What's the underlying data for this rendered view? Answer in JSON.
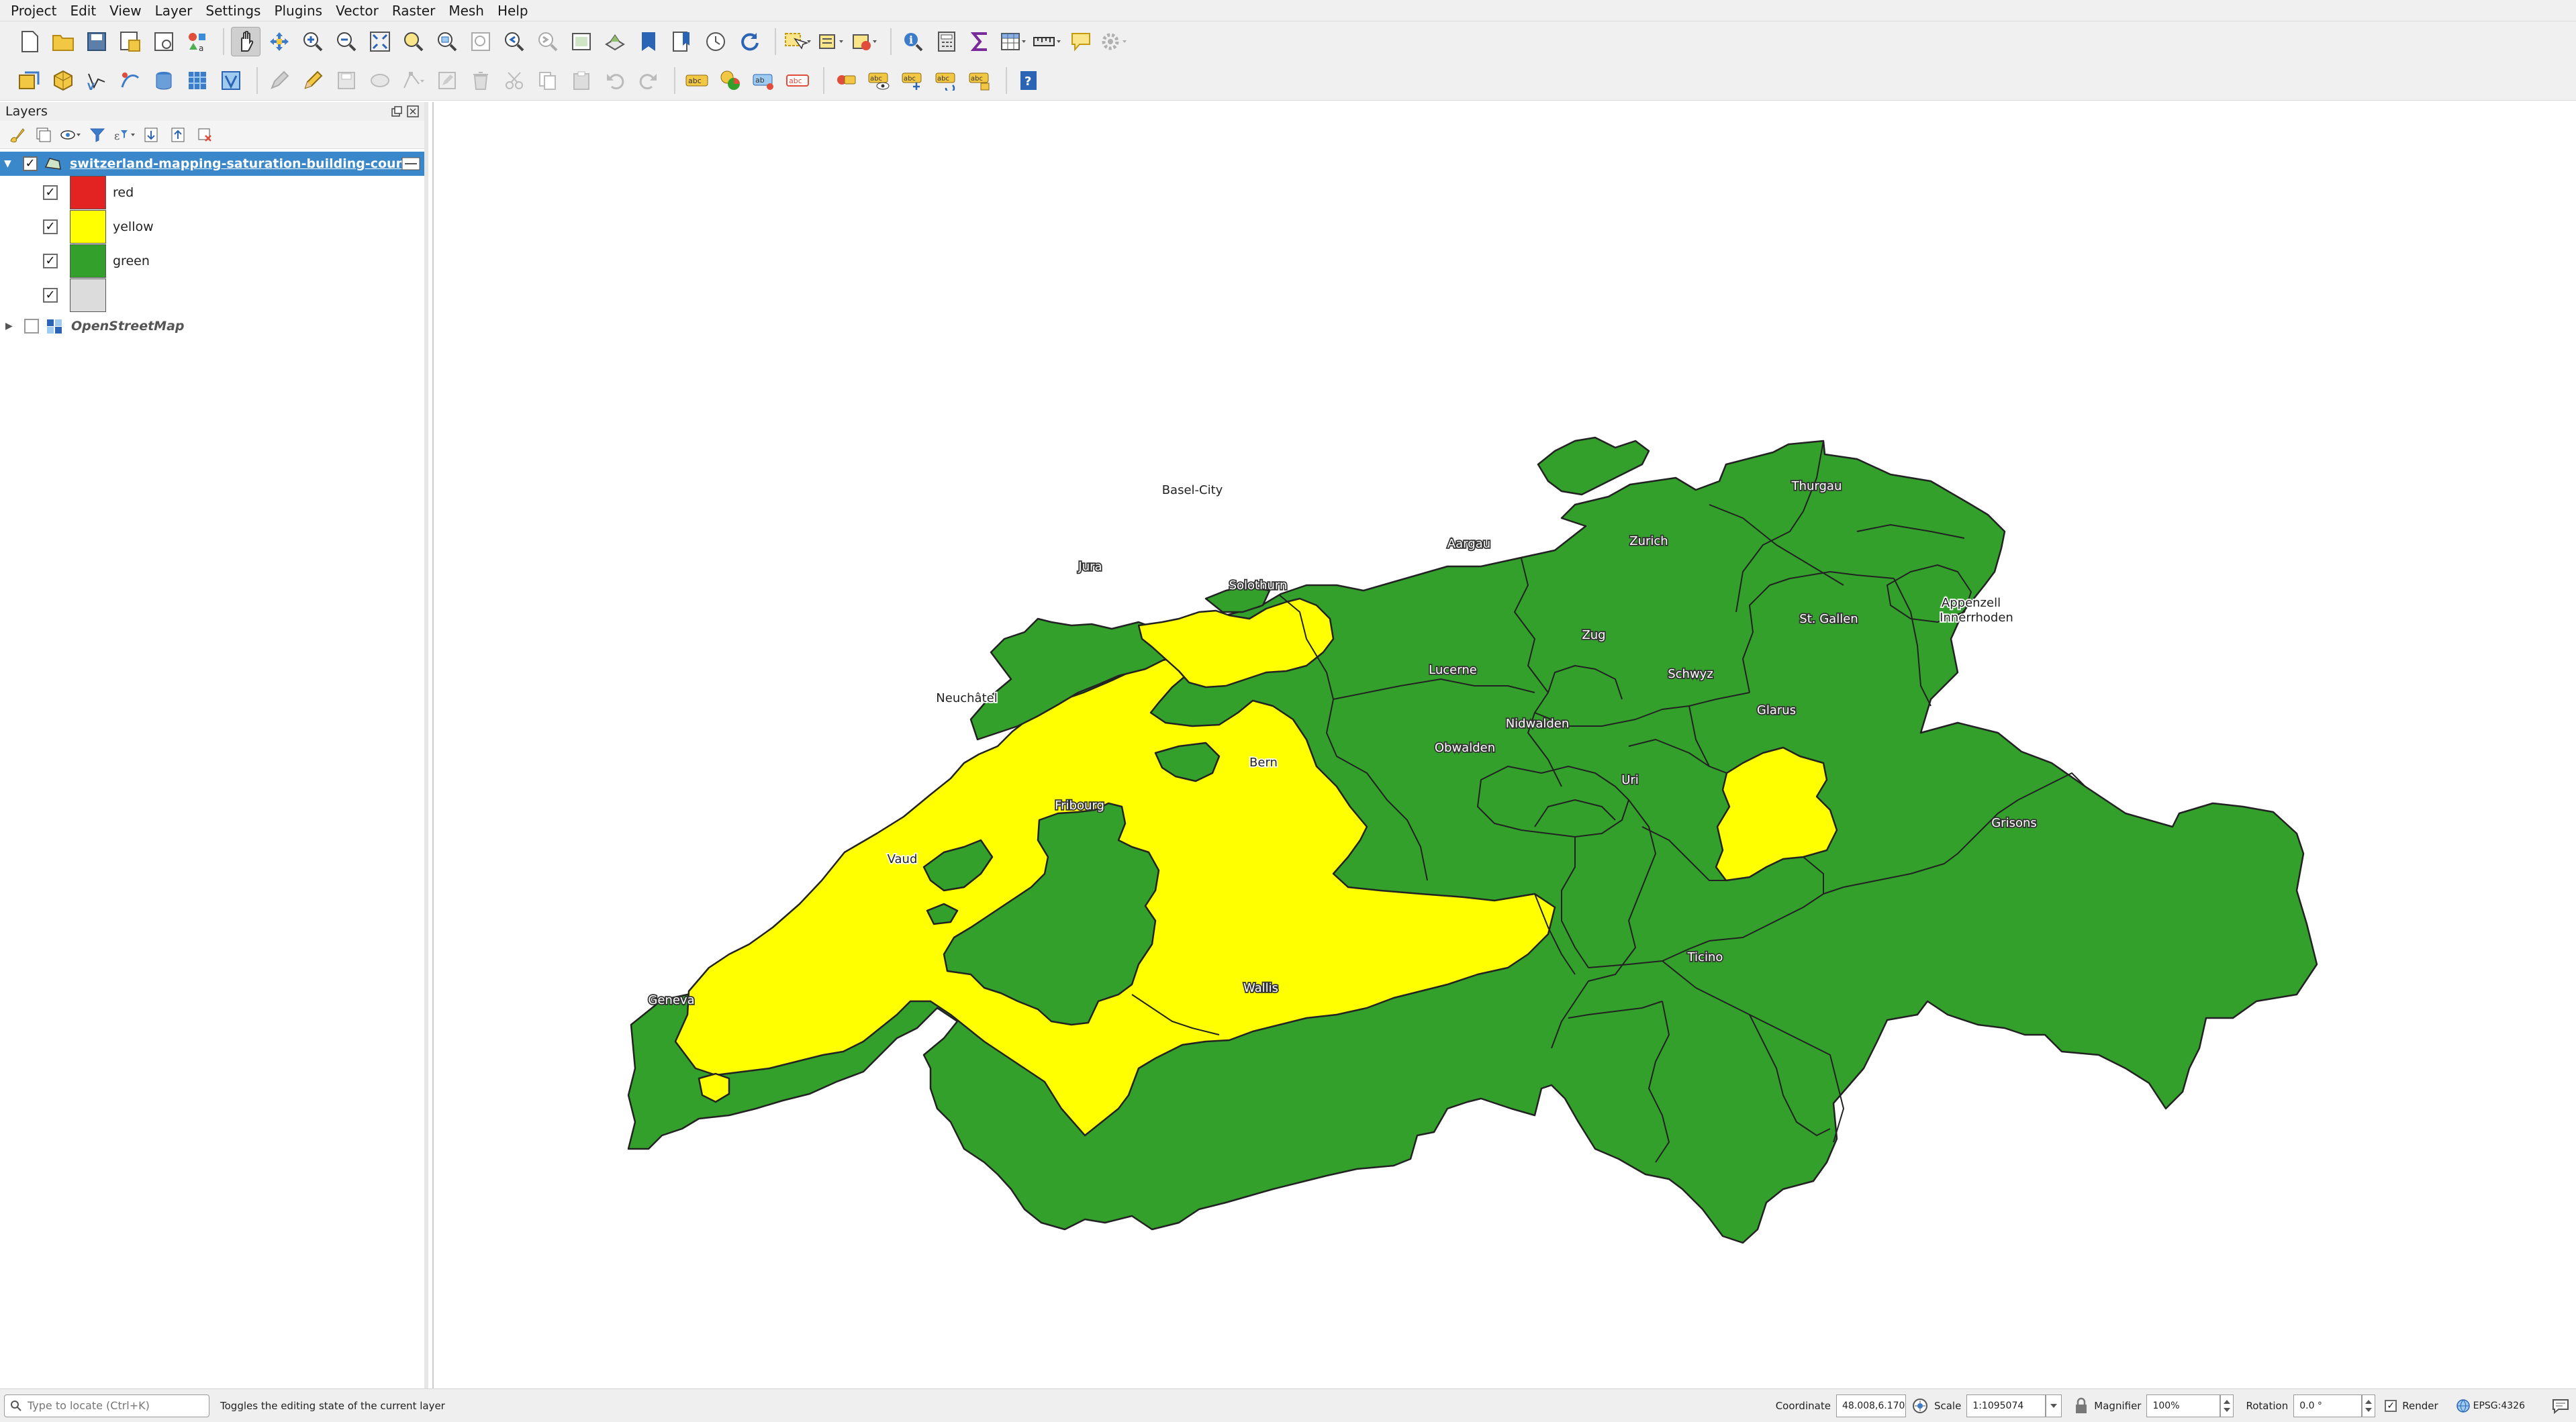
{
  "menu": [
    "Project",
    "Edit",
    "View",
    "Layer",
    "Settings",
    "Plugins",
    "Vector",
    "Raster",
    "Mesh",
    "Help"
  ],
  "layers_panel": {
    "title": "Layers",
    "layer_name": "switzerland-mapping-saturation-building-count",
    "classes": [
      {
        "label": "red",
        "color": "#e32222"
      },
      {
        "label": "yellow",
        "color": "#ffff00"
      },
      {
        "label": "green",
        "color": "#33a02c"
      },
      {
        "label": "",
        "color": "#dcdcdc"
      }
    ],
    "basemap": "OpenStreetMap"
  },
  "map": {
    "fill_green": "#33a02c",
    "fill_yellow": "#ffff00",
    "labels": [
      {
        "text": "Basel-City"
      },
      {
        "text": "Jura"
      },
      {
        "text": "Solothurn"
      },
      {
        "text": "Aargau"
      },
      {
        "text": "Zurich"
      },
      {
        "text": "Thurgau"
      },
      {
        "text": "St. Gallen"
      },
      {
        "text": "Appenzell"
      },
      {
        "text": "Innerrhoden"
      },
      {
        "text": "Neuchâtel"
      },
      {
        "text": "Lucerne"
      },
      {
        "text": "Zug"
      },
      {
        "text": "Schwyz"
      },
      {
        "text": "Glarus"
      },
      {
        "text": "Nidwalden"
      },
      {
        "text": "Obwalden"
      },
      {
        "text": "Bern"
      },
      {
        "text": "Uri"
      },
      {
        "text": "Fribourg"
      },
      {
        "text": "Vaud"
      },
      {
        "text": "Grisons"
      },
      {
        "text": "Ticino"
      },
      {
        "text": "Wallis"
      },
      {
        "text": "Geneva"
      }
    ]
  },
  "status": {
    "locate_placeholder": "Type to locate (Ctrl+K)",
    "message": "Toggles the editing state of the current layer",
    "coordinate_label": "Coordinate",
    "coordinate_value": "48.008,6.170",
    "scale_label": "Scale",
    "scale_value": "1:1095074",
    "magnifier_label": "Magnifier",
    "magnifier_value": "100%",
    "rotation_label": "Rotation",
    "rotation_value": "0.0 °",
    "render_label": "Render",
    "crs": "EPSG:4326"
  }
}
